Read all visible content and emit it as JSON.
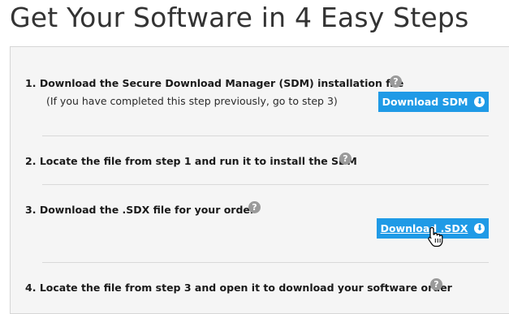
{
  "page": {
    "title": "Get Your Software in 4 Easy Steps"
  },
  "steps": [
    {
      "number": "1.",
      "text": "Download the Secure Download Manager (SDM) installation file",
      "sub": "(If you have completed this step previously, go to step 3)",
      "button": "Download SDM"
    },
    {
      "number": "2.",
      "text": "Locate the file from step 1 and run it to install the SDM"
    },
    {
      "number": "3.",
      "text": "Download the .SDX file for your order",
      "button": "Download .SDX"
    },
    {
      "number": "4.",
      "text": "Locate the file from step 3 and open it to download your software order"
    }
  ],
  "icons": {
    "help": "?",
    "download": "⬇"
  },
  "colors": {
    "button": "#1f9ae6",
    "panel": "#f5f5f5",
    "help_icon": "#9a9a9a"
  }
}
